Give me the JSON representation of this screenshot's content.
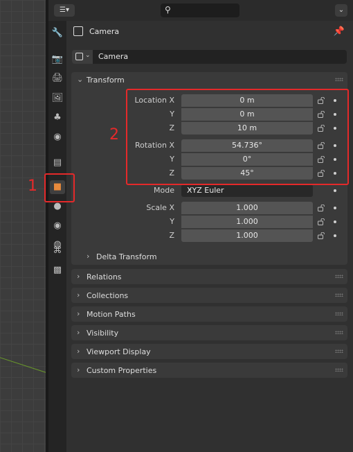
{
  "header": {
    "editor_glyph": "☰▾",
    "search_glyph": "⚲",
    "drop_glyph": "⌄"
  },
  "tabs": [
    {
      "name": "tool-tab",
      "glyph": "🔧"
    },
    {
      "name": "render-tab",
      "glyph": "📷"
    },
    {
      "name": "output-tab",
      "glyph": "🖨"
    },
    {
      "name": "view-layer-tab",
      "glyph": "🖼"
    },
    {
      "name": "scene-tab",
      "glyph": "♣"
    },
    {
      "name": "world-tab",
      "glyph": "◉"
    },
    {
      "name": "collection-tab",
      "glyph": "▤"
    },
    {
      "name": "object-tab",
      "glyph": "■"
    },
    {
      "name": "modifiers-tab",
      "glyph": "●"
    },
    {
      "name": "physics-tab",
      "glyph": "◉"
    },
    {
      "name": "constraints-tab",
      "glyph": "◍"
    },
    {
      "name": "data-tab",
      "glyph": "⌘"
    },
    {
      "name": "texture-tab",
      "glyph": "▩"
    }
  ],
  "title": "Camera",
  "pin_glyph": "📌",
  "object_name": "Camera",
  "transform": {
    "label": "Transform",
    "location_label": "Location X",
    "rotation_label": "Rotation X",
    "scale_label": "Scale X",
    "y_label": "Y",
    "z_label": "Z",
    "location": [
      "0 m",
      "0 m",
      "10 m"
    ],
    "rotation": [
      "54.736°",
      "0°",
      "45°"
    ],
    "scale": [
      "1.000",
      "1.000",
      "1.000"
    ],
    "mode_label": "Mode",
    "mode_value": "XYZ Euler",
    "delta_label": "Delta Transform"
  },
  "sections": [
    "Relations",
    "Collections",
    "Motion Paths",
    "Visibility",
    "Viewport Display",
    "Custom Properties"
  ],
  "annotations": {
    "one": "1",
    "two": "2"
  },
  "colors": {
    "accent": "#e88a3c",
    "annotation": "#e5292a",
    "field": "#545454"
  }
}
